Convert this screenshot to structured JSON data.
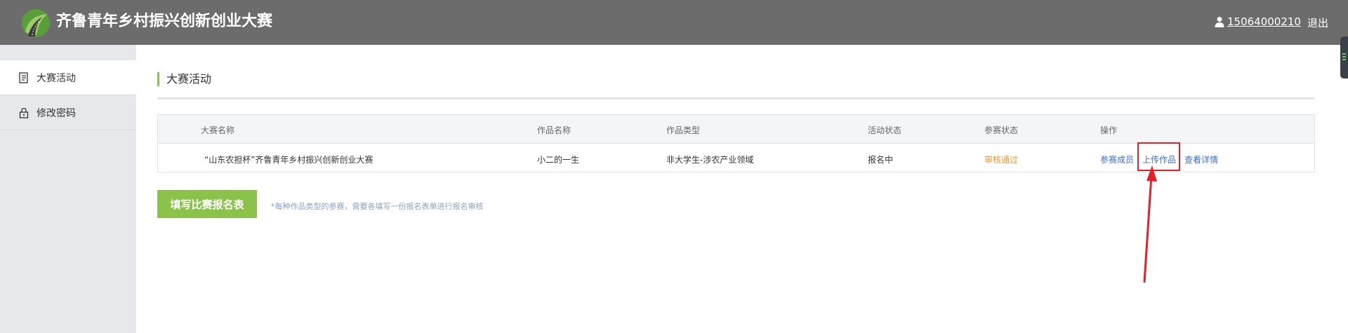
{
  "header": {
    "title": "齐鲁青年乡村振兴创新创业大赛",
    "user_phone": "15064000210",
    "logout": "退出",
    "background": "#6c6c6c",
    "icons": {
      "logo": "leaf-road-logo",
      "user": "user-icon"
    }
  },
  "sidebar": {
    "items": [
      {
        "label": "大赛活动",
        "icon": "document-list-icon",
        "active": true
      },
      {
        "label": "修改密码",
        "icon": "lock-icon",
        "active": false
      }
    ]
  },
  "main": {
    "section_title": "大赛活动",
    "table": {
      "headers": [
        "大赛名称",
        "作品名称",
        "作品类型",
        "活动状态",
        "参赛状态",
        "操作"
      ],
      "rows": [
        {
          "contest_name": "“山东农担杯”齐鲁青年乡村振兴创新创业大赛",
          "work_name": "小二的一生",
          "work_type": "非大学生-涉农产业领域",
          "activity_status": "报名中",
          "entry_status": "审核通过",
          "actions": [
            "参赛成员",
            "上传作品",
            "查看详情"
          ]
        }
      ]
    },
    "fill_form_button": "填写比赛报名表",
    "hint": "*每种作品类型的参赛，需要各填写一份报名表单进行报名审核"
  },
  "colors": {
    "accent_green": "#8bc34a",
    "status_orange": "#f0952b",
    "link_blue": "#3c6fd1",
    "highlight_red": "#e0232b"
  }
}
